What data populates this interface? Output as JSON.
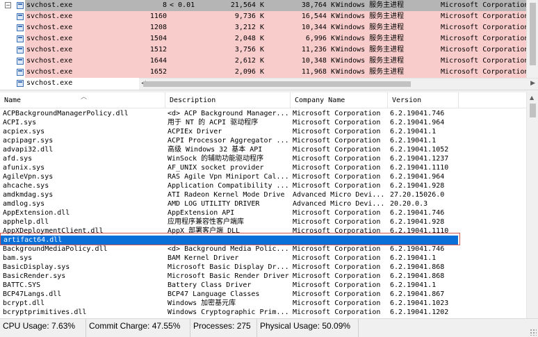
{
  "processes": [
    {
      "name": "svchost.exe",
      "pid": "8",
      "cpu": "< 0.01",
      "private_bytes": "21,564 K",
      "working_set": "38,764 K",
      "description": "Windows 服务主进程",
      "company": "Microsoft Corporation",
      "state": "selected"
    },
    {
      "name": "svchost.exe",
      "pid": "1160",
      "cpu": "",
      "private_bytes": "9,736 K",
      "working_set": "16,544 K",
      "description": "Windows 服务主进程",
      "company": "Microsoft Corporation",
      "state": "service"
    },
    {
      "name": "svchost.exe",
      "pid": "1208",
      "cpu": "",
      "private_bytes": "3,212 K",
      "working_set": "10,344 K",
      "description": "Windows 服务主进程",
      "company": "Microsoft Corporation",
      "state": "service"
    },
    {
      "name": "svchost.exe",
      "pid": "1504",
      "cpu": "",
      "private_bytes": "2,048 K",
      "working_set": "6,996 K",
      "description": "Windows 服务主进程",
      "company": "Microsoft Corporation",
      "state": "service"
    },
    {
      "name": "svchost.exe",
      "pid": "1512",
      "cpu": "",
      "private_bytes": "3,756 K",
      "working_set": "11,236 K",
      "description": "Windows 服务主进程",
      "company": "Microsoft Corporation",
      "state": "service"
    },
    {
      "name": "svchost.exe",
      "pid": "1644",
      "cpu": "",
      "private_bytes": "2,612 K",
      "working_set": "10,348 K",
      "description": "Windows 服务主进程",
      "company": "Microsoft Corporation",
      "state": "service"
    },
    {
      "name": "svchost.exe",
      "pid": "1652",
      "cpu": "",
      "private_bytes": "2,096 K",
      "working_set": "11,968 K",
      "description": "Windows 服务主进程",
      "company": "Microsoft Corporation",
      "state": "service"
    },
    {
      "name": "svchost.exe",
      "pid": "",
      "cpu": "",
      "private_bytes": "",
      "working_set": "",
      "description": "",
      "company": "",
      "state": "normal"
    }
  ],
  "dll_columns": {
    "name": "Name",
    "description": "Description",
    "company": "Company Name",
    "version": "Version"
  },
  "dlls": [
    {
      "name": "ACPBackgroundManagerPolicy.dll",
      "description": "<d> ACP Background Manager...",
      "company": "Microsoft Corporation",
      "version": "6.2.19041.746"
    },
    {
      "name": "ACPI.sys",
      "description": "用于 NT 的 ACPI 驱动程序",
      "company": "Microsoft Corporation",
      "version": "6.2.19041.964"
    },
    {
      "name": "acpiex.sys",
      "description": "ACPIEx Driver",
      "company": "Microsoft Corporation",
      "version": "6.2.19041.1"
    },
    {
      "name": "acpipagr.sys",
      "description": "ACPI Processor Aggregator ...",
      "company": "Microsoft Corporation",
      "version": "6.2.19041.1"
    },
    {
      "name": "advapi32.dll",
      "description": "高级 Windows 32 基本 API",
      "company": "Microsoft Corporation",
      "version": "6.2.19041.1052"
    },
    {
      "name": "afd.sys",
      "description": "WinSock 的辅助功能驱动程序",
      "company": "Microsoft Corporation",
      "version": "6.2.19041.1237"
    },
    {
      "name": "afunix.sys",
      "description": "AF_UNIX socket provider",
      "company": "Microsoft Corporation",
      "version": "6.2.19041.1110"
    },
    {
      "name": "AgileVpn.sys",
      "description": "RAS Agile Vpn Miniport Cal...",
      "company": "Microsoft Corporation",
      "version": "6.2.19041.964"
    },
    {
      "name": "ahcache.sys",
      "description": "Application Compatibility ...",
      "company": "Microsoft Corporation",
      "version": "6.2.19041.928"
    },
    {
      "name": "amdkmdag.sys",
      "description": "ATI Radeon Kernel Mode Drive",
      "company": "Advanced Micro Devi...",
      "version": "27.20.15026.0"
    },
    {
      "name": "amdlog.sys",
      "description": "AMD LOG UTILITY DRIVER",
      "company": "Advanced Micro Devi...",
      "version": "20.20.0.3"
    },
    {
      "name": "AppExtension.dll",
      "description": "AppExtension API",
      "company": "Microsoft Corporation",
      "version": "6.2.19041.746"
    },
    {
      "name": "apphelp.dll",
      "description": "应用程序兼容性客户端库",
      "company": "Microsoft Corporation",
      "version": "6.2.19041.928"
    },
    {
      "name": "AppXDeploymentClient.dll",
      "description": "AppX 部署客户端 DLL",
      "company": "Microsoft Corporation",
      "version": "6.2.19041.1110"
    },
    {
      "name": "artifact64.dll",
      "description": "",
      "company": "",
      "version": "",
      "highlight": true
    },
    {
      "name": "BackgroundMediaPolicy.dll",
      "description": "<d> Background Media Polic...",
      "company": "Microsoft Corporation",
      "version": "6.2.19041.746"
    },
    {
      "name": "bam.sys",
      "description": "BAM Kernel Driver",
      "company": "Microsoft Corporation",
      "version": "6.2.19041.1"
    },
    {
      "name": "BasicDisplay.sys",
      "description": "Microsoft Basic Display Dr...",
      "company": "Microsoft Corporation",
      "version": "6.2.19041.868"
    },
    {
      "name": "BasicRender.sys",
      "description": "Microsoft Basic Render Driver",
      "company": "Microsoft Corporation",
      "version": "6.2.19041.868"
    },
    {
      "name": "BATTC.SYS",
      "description": "Battery Class Driver",
      "company": "Microsoft Corporation",
      "version": "6.2.19041.1"
    },
    {
      "name": "BCP47Langs.dll",
      "description": "BCP47 Language Classes",
      "company": "Microsoft Corporation",
      "version": "6.2.19041.867"
    },
    {
      "name": "bcrypt.dll",
      "description": "Windows 加密基元库",
      "company": "Microsoft Corporation",
      "version": "6.2.19041.1023"
    },
    {
      "name": "bcryptprimitives.dll",
      "description": "Windows Cryptographic Prim...",
      "company": "Microsoft Corporation",
      "version": "6.2.19041.1202"
    }
  ],
  "status_bar": {
    "cpu_usage": "CPU Usage: 7.63%",
    "commit_charge": "Commit Charge: 47.55%",
    "processes": "Processes: 275",
    "physical_usage": "Physical Usage: 50.09%"
  },
  "colors": {
    "service_row": "#f9cccc",
    "selected_row": "#b5b5b5",
    "highlight_row": "#0a6fd6",
    "highlight_box": "#d9534f"
  }
}
